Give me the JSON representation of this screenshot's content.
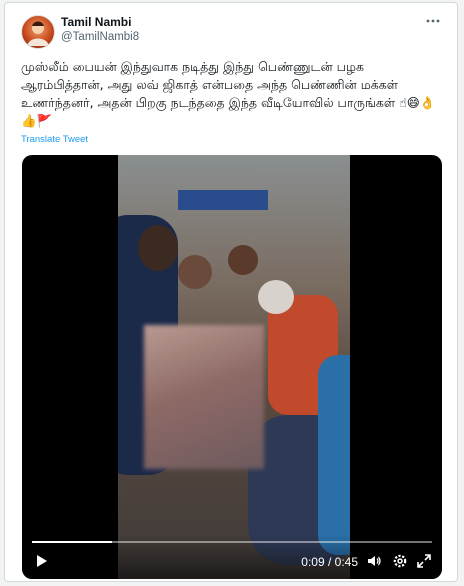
{
  "tweet": {
    "author_name": "Tamil Nambi",
    "author_handle": "@TamilNambi8",
    "more_icon": "more-horizontal-icon",
    "text": "முஸ்லீம் பையன் இந்துவாக நடித்து இந்து பெண்ணுடன் பழக ஆரம்பித்தான், அது லவ் ஜிகாத் என்பதை அந்த பெண்ணின் மக்கள் உணர்ந்தனர், அதன் பிறகு நடந்ததை இந்த வீடியோவில் பாருங்கள்",
    "emojis": "☝😄👌👍🚩",
    "translate_label": "Translate Tweet"
  },
  "video": {
    "time_display": "0:09 / 0:45",
    "progress": 0.2,
    "play_icon": "play-icon",
    "volume_icon": "volume-icon",
    "settings_icon": "settings-icon",
    "fullscreen_icon": "fullscreen-icon"
  },
  "colors": {
    "link": "#1d9bf0",
    "secondary_text": "#536471",
    "border": "#cfd9de",
    "video_bg": "#000000"
  }
}
